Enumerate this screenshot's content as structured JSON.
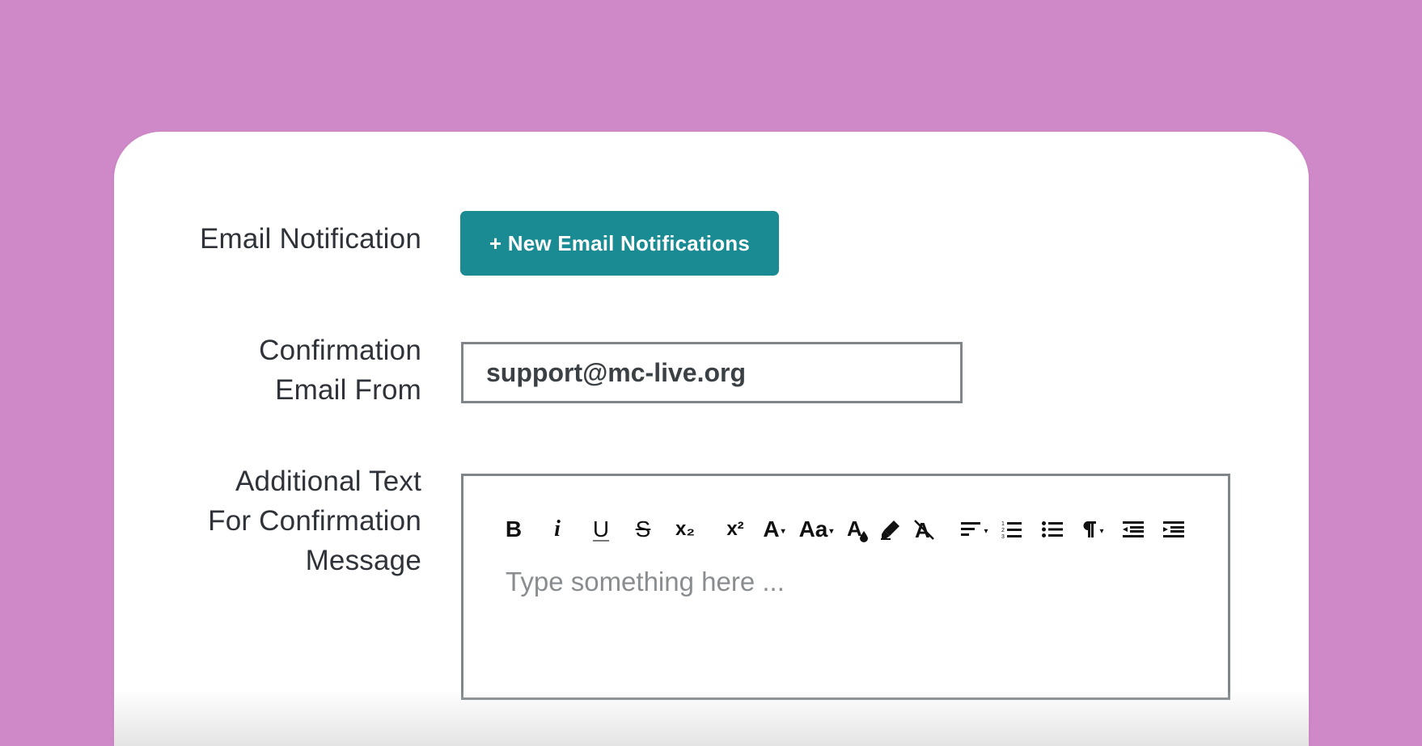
{
  "form": {
    "email_notification_label": "Email Notification",
    "new_button_label": "+ New Email Notifications",
    "confirmation_from_label": "Confirmation\nEmail From",
    "confirmation_from_value": "support@mc-live.org",
    "additional_text_label": "Additional Text\nFor Confirmation\nMessage",
    "editor_placeholder": "Type something here ..."
  },
  "toolbar": {
    "bold": "B",
    "italic": "i",
    "underline": "U",
    "strike": "S",
    "subscript": "x₂",
    "superscript": "x²",
    "font_size": "A",
    "font_case": "Aa"
  },
  "colors": {
    "background": "#cf89c8",
    "button": "#1a8b92",
    "border": "#7f8588",
    "label_text": "#2f3238"
  }
}
